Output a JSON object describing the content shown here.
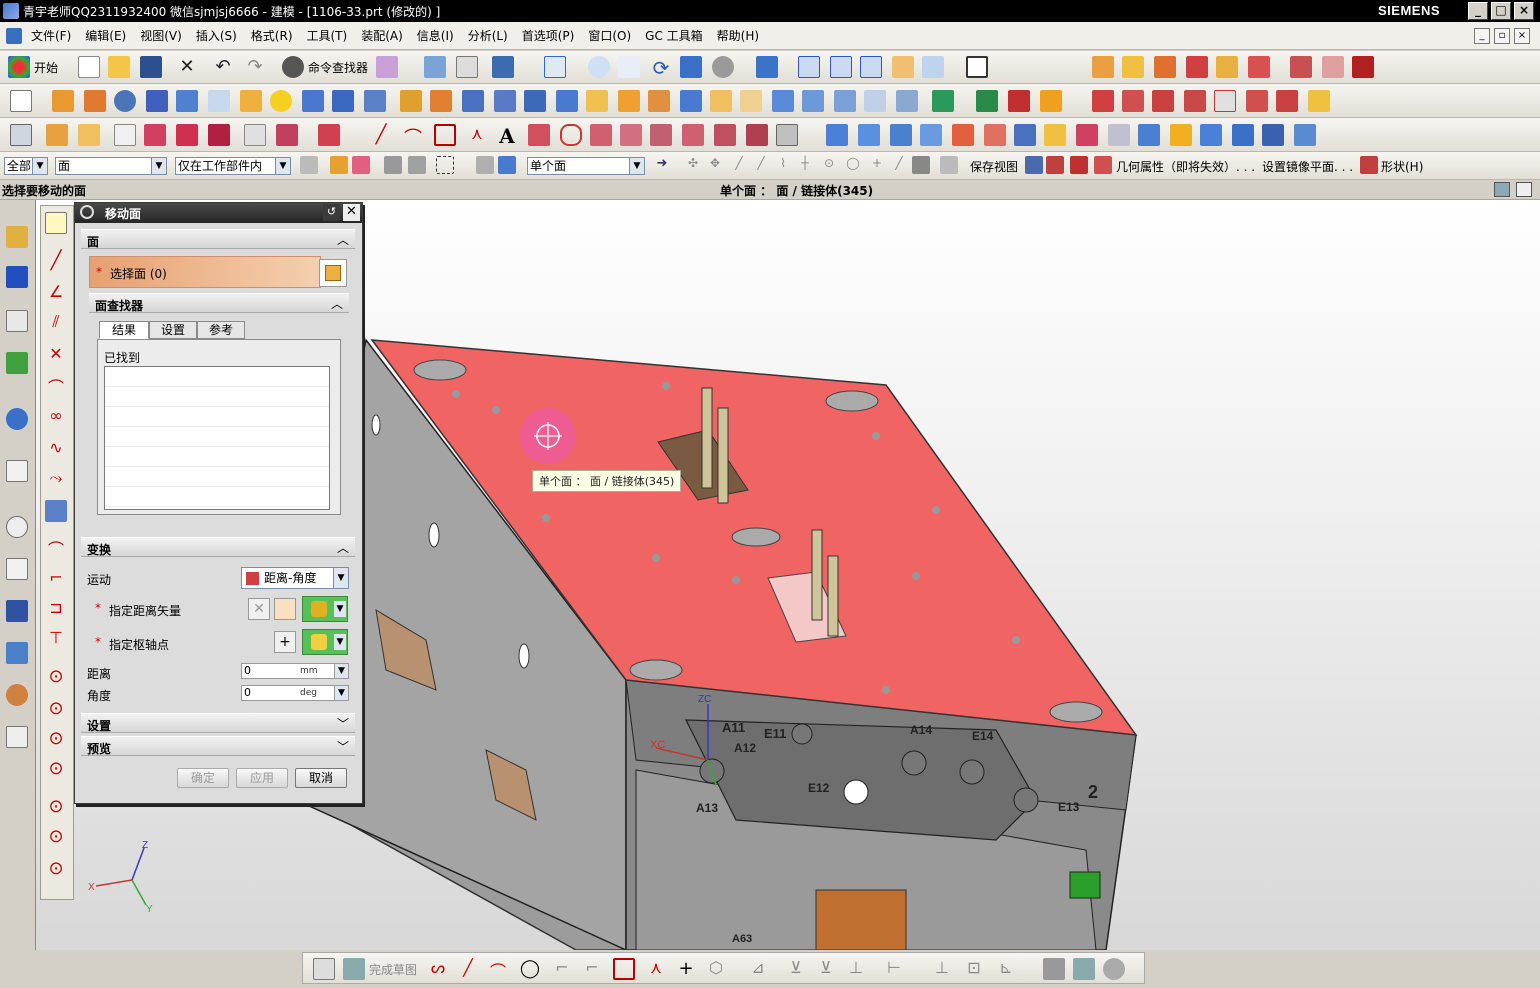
{
  "window": {
    "title": "青宇老师QQ2311932400 微信sjmjsj6666 - 建模 - [1106-33.prt  (修改的) ]",
    "brand": "SIEMENS"
  },
  "menu": [
    "文件(F)",
    "编辑(E)",
    "视图(V)",
    "插入(S)",
    "格式(R)",
    "工具(T)",
    "装配(A)",
    "信息(I)",
    "分析(L)",
    "首选项(P)",
    "窗口(O)",
    "GC 工具箱",
    "帮助(H)"
  ],
  "toolbar1": {
    "start_label": "开始",
    "command_finder_label": "命令查找器"
  },
  "selection_bar": {
    "filter": "全部",
    "type": "面",
    "scope": "仅在工作部件内",
    "face_rule": "单个面",
    "save_view": "保存视图",
    "geom_prop": "几何属性（即将失效）. . .",
    "mirror_plane": "设置镜像平面. . .",
    "shape": "形状(H)"
  },
  "cue": {
    "prompt": "选择要移动的面",
    "status": "单个面 ： 面 / 链接体(345)"
  },
  "dialog": {
    "title": "移动面",
    "face_group": "面",
    "select_face": "选择面 (0)",
    "face_finder": "面查找器",
    "tabs": [
      "结果",
      "设置",
      "参考"
    ],
    "found_label": "已找到",
    "transform_group": "变换",
    "motion_label": "运动",
    "motion_value": "距离-角度",
    "distance_vector": "指定距离矢量",
    "pivot_point": "指定枢轴点",
    "distance_label": "距离",
    "distance_value": "0",
    "distance_unit": "mm",
    "angle_label": "角度",
    "angle_value": "0",
    "angle_unit": "deg",
    "settings_group": "设置",
    "preview_group": "预览",
    "ok": "确定",
    "apply": "应用",
    "cancel": "取消"
  },
  "viewport": {
    "tooltip": "单个面 ： 面 / 链接体(345)",
    "labels": [
      "A11",
      "E11",
      "A12",
      "A14",
      "E14",
      "E12",
      "E13",
      "A13",
      "A63",
      "2",
      "XC",
      "ZC",
      "X",
      "Y",
      "Z"
    ]
  },
  "sketch_bar": {
    "finish_sketch": "完成草图"
  },
  "colors": {
    "selected_face": "#f06464",
    "plate": "#8c8c8c",
    "title_bg": "#000000"
  }
}
